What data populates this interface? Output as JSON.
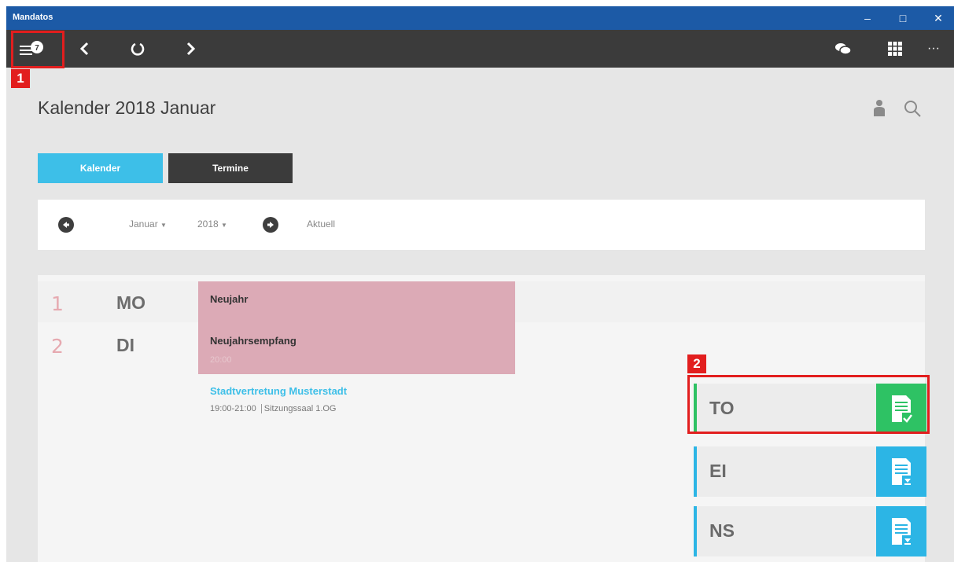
{
  "window": {
    "title": "Mandatos",
    "minimize": "‒",
    "maximize": "□",
    "close": "✕"
  },
  "toolbar": {
    "menu_badge": "7",
    "more": "···"
  },
  "callouts": [
    "1",
    "2"
  ],
  "page_title": "Kalender 2018 Januar",
  "tabs": [
    {
      "label": "Kalender",
      "active": true
    },
    {
      "label": "Termine",
      "active": false
    }
  ],
  "nav": {
    "month": "Januar",
    "year": "2018",
    "current": "Aktuell"
  },
  "days": [
    {
      "num": "1",
      "name": "MO",
      "events": [
        {
          "title": "Neujahr"
        }
      ]
    },
    {
      "num": "2",
      "name": "DI",
      "events": [
        {
          "title": "Neujahrsempfang",
          "time": "20:00"
        },
        {
          "title": "Stadtvertretung Musterstadt",
          "time": "19:00-21:00",
          "location": "Sitzungssaal 1.OG"
        }
      ]
    }
  ],
  "documents": [
    {
      "label": "TO",
      "color": "#2ec264",
      "icon": "document-check-icon"
    },
    {
      "label": "EI",
      "color": "#2cb5e5",
      "icon": "document-download-icon"
    },
    {
      "label": "NS",
      "color": "#2cb5e5",
      "icon": "document-download-icon"
    }
  ],
  "colors": {
    "accent": "#3dbfe8",
    "event_pink": "#dcaab6",
    "titlebar": "#1c5aa6",
    "toolbar": "#3b3b3b",
    "callout_red": "#e21e1e"
  }
}
